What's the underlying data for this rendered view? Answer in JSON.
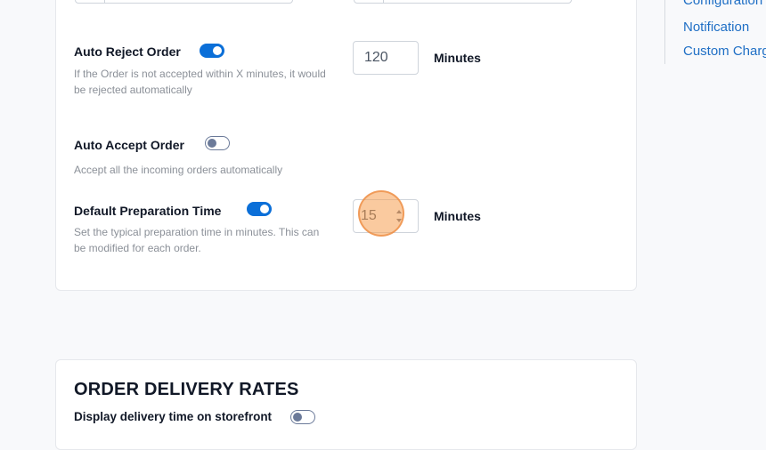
{
  "settings": {
    "auto_reject": {
      "label": "Auto Reject Order",
      "description": "If the Order is not accepted within X minutes, it would be rejected automatically",
      "enabled": true,
      "value": "120",
      "unit": "Minutes"
    },
    "auto_accept": {
      "label": "Auto Accept Order",
      "description": "Accept all the incoming orders automatically",
      "enabled": false
    },
    "default_prep": {
      "label": "Default Preparation Time",
      "description": "Set the typical preparation time in minutes. This can be modified for each order.",
      "enabled": true,
      "value": "15",
      "unit": "Minutes"
    }
  },
  "delivery": {
    "title": "ORDER DELIVERY RATES",
    "display_time": {
      "label": "Display delivery time on storefront",
      "enabled": false
    }
  },
  "side_nav": {
    "items": [
      {
        "label": "Configuration"
      },
      {
        "label": "Notification"
      },
      {
        "label": "Custom Charges"
      }
    ]
  },
  "colors": {
    "accent": "#0b6fd8",
    "link": "#1f6fc5",
    "toggle_off": "#6b7a99",
    "cursor_highlight": "#f59e50"
  }
}
